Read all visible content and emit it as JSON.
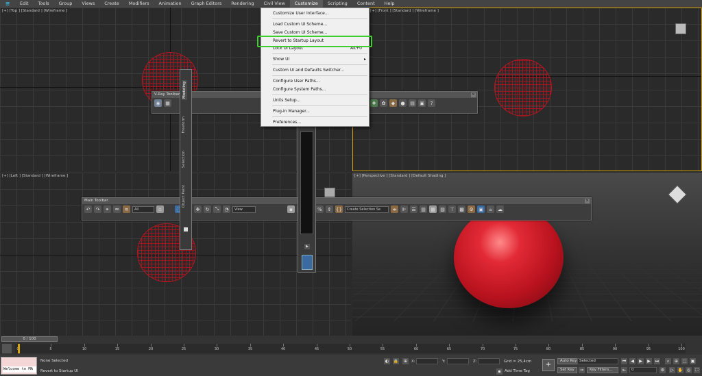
{
  "menubar": {
    "items": [
      "Edit",
      "Tools",
      "Group",
      "Views",
      "Create",
      "Modifiers",
      "Animation",
      "Graph Editors",
      "Rendering",
      "Civil View",
      "Customize",
      "Scripting",
      "Content",
      "Help"
    ]
  },
  "viewports": {
    "top_label": "[+] [Top ] [Standard ] [Wireframe ]",
    "front_label": "[+] [Front ] [Standard ] [Wireframe ]",
    "left_label": "[+] [Left ] [Standard ] [Wireframe ]",
    "persp_label": "[+] [Perspective ] [Standard ] [Default Shading ]"
  },
  "vray_toolbar": {
    "title": "V-Ray Toolbar"
  },
  "main_toolbar": {
    "title": "Main Toolbar",
    "filter": "All",
    "ref_coord": "View",
    "named_selection": "Create Selection Se"
  },
  "ribbon": {
    "tabs": [
      "Modeling",
      "Freeform",
      "Selection",
      "Object Paint"
    ]
  },
  "customize_menu": {
    "items": [
      {
        "label": "Customize User Interface..."
      },
      {
        "label": "Load Custom UI Scheme..."
      },
      {
        "label": "Save Custom UI Scheme..."
      },
      {
        "label": "Revert to Startup Layout"
      },
      {
        "label": "Lock UI Layout",
        "shortcut": "Alt+0"
      },
      {
        "label": "Show UI",
        "submenu": "▸"
      },
      {
        "label": "Custom UI and Defaults Switcher..."
      },
      {
        "label": "Configure User Paths..."
      },
      {
        "label": "Configure System Paths..."
      },
      {
        "label": "Units Setup..."
      },
      {
        "label": "Plug-in Manager..."
      },
      {
        "label": "Preferences..."
      }
    ]
  },
  "timeline": {
    "slider": "0 / 100",
    "ticks": [
      "0",
      "5",
      "10",
      "15",
      "20",
      "25",
      "30",
      "35",
      "40",
      "45",
      "50",
      "55",
      "60",
      "65",
      "70",
      "75",
      "80",
      "85",
      "90",
      "95",
      "100"
    ]
  },
  "status": {
    "maxscript": "Welcome to MA",
    "selection": "None Selected",
    "prompt": "Revert to Startup UI",
    "x_label": "X:",
    "y_label": "Y:",
    "z_label": "Z:",
    "grid": "Grid = 25,4cm",
    "add_time_tag": "Add Time Tag",
    "auto_key": "Auto Key",
    "set_key": "Set Key",
    "selected": "Selected",
    "key_filters": "Key Filters...",
    "frame": "0"
  },
  "colors": {
    "highlight": "#3ecf2e",
    "active_border": "#d9a600",
    "sphere": "#cc1f2b"
  }
}
